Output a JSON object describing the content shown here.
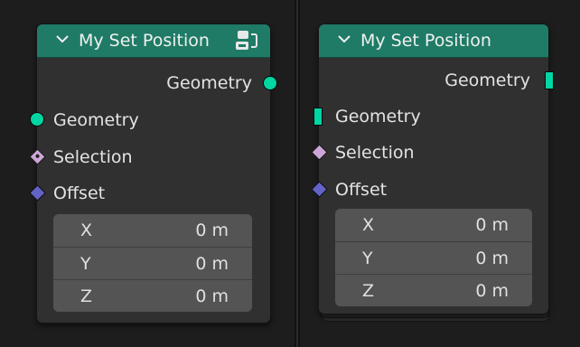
{
  "left_node": {
    "title": "My Set Position",
    "output": {
      "label": "Geometry",
      "socket_icon": "circle-socket-icon",
      "socket_color": "#00d6a3"
    },
    "inputs": [
      {
        "label": "Geometry",
        "socket_icon": "circle-socket-icon",
        "socket_color": "#00d6a3"
      },
      {
        "label": "Selection",
        "socket_icon": "diamond-dot-socket-icon",
        "socket_color": "#cca6d6"
      },
      {
        "label": "Offset",
        "socket_icon": "diamond-socket-icon",
        "socket_color": "#6363c7"
      }
    ],
    "vector": [
      {
        "axis": "X",
        "value": "0 m"
      },
      {
        "axis": "Y",
        "value": "0 m"
      },
      {
        "axis": "Z",
        "value": "0 m"
      }
    ],
    "header_icon": "node-group-icon"
  },
  "right_node": {
    "title": "My Set Position",
    "output": {
      "label": "Geometry",
      "socket_icon": "bar-socket-icon",
      "socket_color": "#00d6a3"
    },
    "inputs": [
      {
        "label": "Geometry",
        "socket_icon": "bar-socket-icon",
        "socket_color": "#00d6a3"
      },
      {
        "label": "Selection",
        "socket_icon": "diamond-socket-icon",
        "socket_color": "#cca6d6"
      },
      {
        "label": "Offset",
        "socket_icon": "diamond-socket-icon",
        "socket_color": "#6363c7"
      }
    ],
    "vector": [
      {
        "axis": "X",
        "value": "0 m"
      },
      {
        "axis": "Y",
        "value": "0 m"
      },
      {
        "axis": "Z",
        "value": "0 m"
      }
    ]
  },
  "colors": {
    "header": "#1f7b66",
    "node_body": "#303030",
    "background": "#1d1d1d",
    "field": "#545454"
  }
}
